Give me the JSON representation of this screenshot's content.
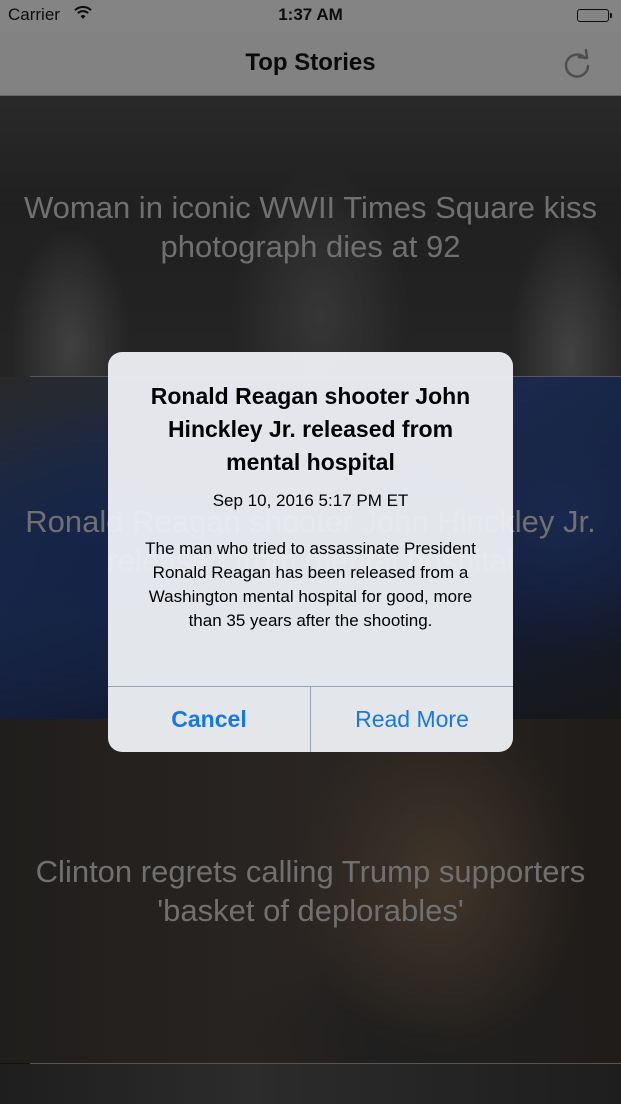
{
  "status_bar": {
    "carrier": "Carrier",
    "time": "1:37 AM",
    "wifi_icon": "wifi-icon",
    "battery_level": 1.0
  },
  "nav": {
    "title": "Top Stories",
    "refresh_icon": "refresh-icon"
  },
  "stories": [
    {
      "headline": "Woman in iconic WWII Times Square kiss photograph dies at 92"
    },
    {
      "headline": "Ronald Reagan shooter John Hinckley Jr. released from mental hospital"
    },
    {
      "headline": "Clinton regrets calling Trump supporters 'basket of deplorables'"
    },
    {
      "headline": ""
    }
  ],
  "alert": {
    "title": "Ronald Reagan shooter John Hinckley Jr. released from mental hospital",
    "date": "Sep 10, 2016 5:17 PM ET",
    "message": "The man who tried to assassinate President Ronald Reagan has been released from a Washington mental hospital for good, more than 35 years after the shooting.",
    "cancel_label": "Cancel",
    "read_more_label": "Read More"
  },
  "colors": {
    "accent": "#1578ea",
    "headline_text": "#9c9c9c",
    "bar_background": "#b7b7b7"
  }
}
